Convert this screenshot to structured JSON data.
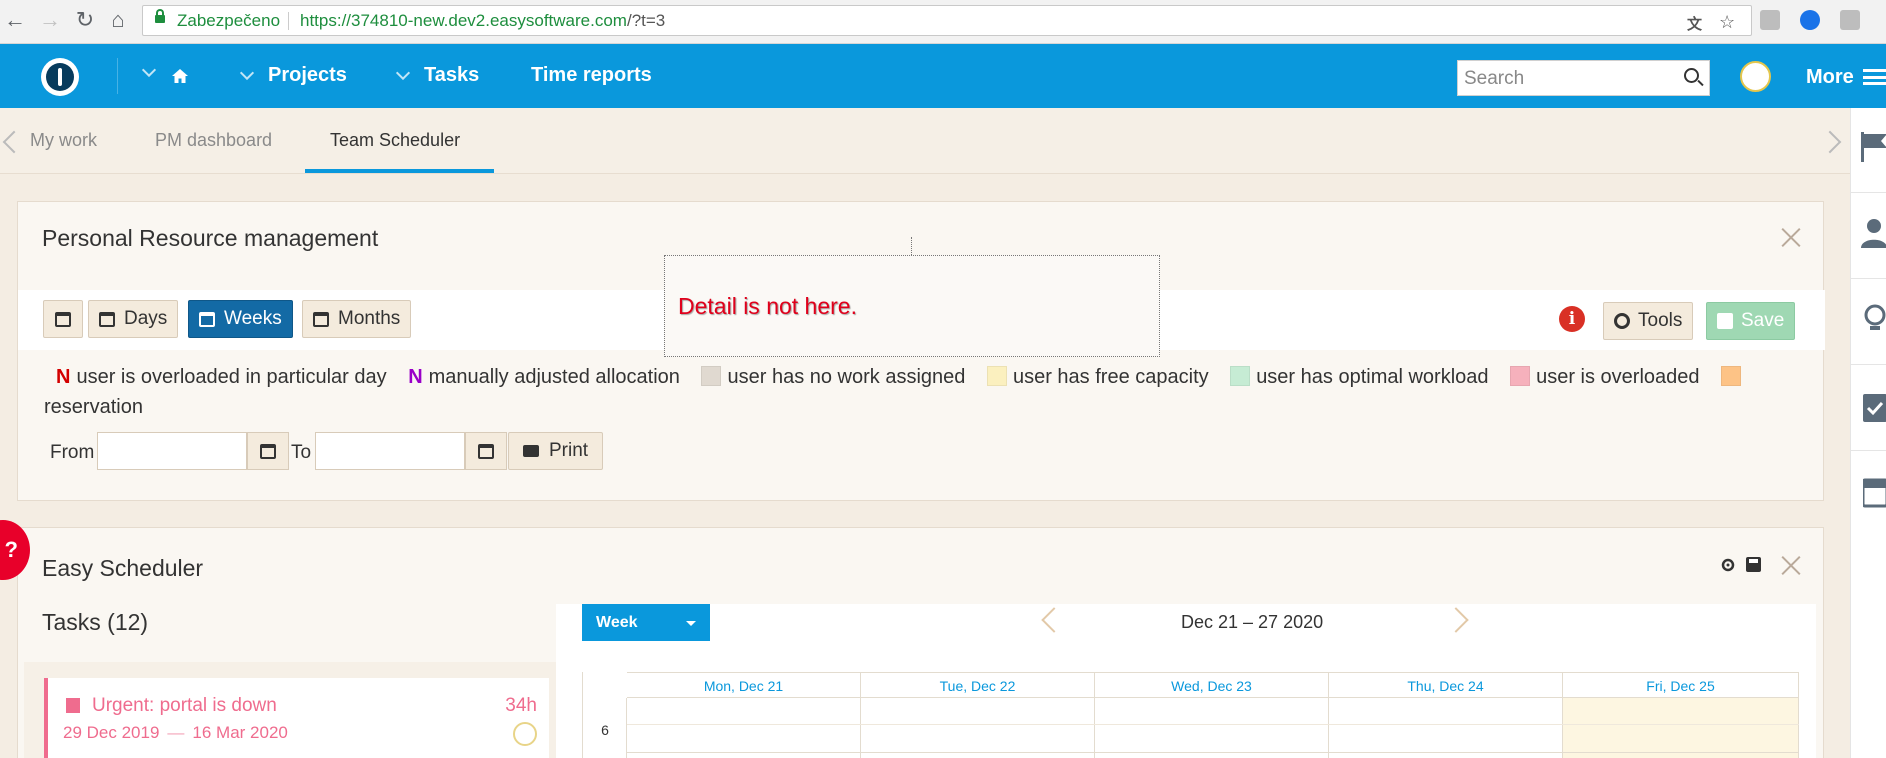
{
  "browser": {
    "secure_label": "Zabezpečeno",
    "url_host": "https://374810-new.dev2.easysoftware.com",
    "url_path": "/?t=3"
  },
  "header": {
    "projects_label": "Projects",
    "tasks_label": "Tasks",
    "time_reports_label": "Time reports",
    "search_placeholder": "Search",
    "more_label": "More"
  },
  "tabs": [
    {
      "label": "My work"
    },
    {
      "label": "PM dashboard"
    },
    {
      "label": "Team Scheduler"
    }
  ],
  "resource_panel": {
    "title": "Personal Resource management",
    "days_label": "Days",
    "weeks_label": "Weeks",
    "months_label": "Months",
    "tools_label": "Tools",
    "save_label": "Save",
    "legend": {
      "overloaded_day_mark": "N",
      "overloaded_day_text": "user is overloaded in particular day",
      "manual_mark": "N",
      "manual_text": "manually adjusted allocation",
      "no_work_text": "user has no work assigned",
      "free_capacity_text": "user has free capacity",
      "optimal_text": "user has optimal workload",
      "overloaded_text": "user is overloaded",
      "reservation_text": "reservation"
    },
    "legend_colors": {
      "no_work": "#e0d9d0",
      "free_capacity": "#fbf0bf",
      "optimal": "#c6ecd4",
      "overloaded": "#f6b1bc",
      "reservation": "#fdc386"
    },
    "from_label": "From",
    "to_label": "To",
    "print_label": "Print",
    "annotation": "Detail is not here."
  },
  "scheduler_panel": {
    "title": "Easy Scheduler",
    "tasks_heading": "Tasks (12)",
    "view_select": "Week",
    "range_label": "Dec 21 – 27 2020",
    "days": [
      "Mon, Dec 21",
      "Tue, Dec 22",
      "Wed, Dec 23",
      "Thu, Dec 24",
      "Fri, Dec 25"
    ],
    "hour_label": "6",
    "task": {
      "title": "Urgent: portal is down",
      "hours": "34h",
      "start": "29 Dec 2019",
      "end": "16 Mar 2020"
    }
  },
  "help_label": "?"
}
